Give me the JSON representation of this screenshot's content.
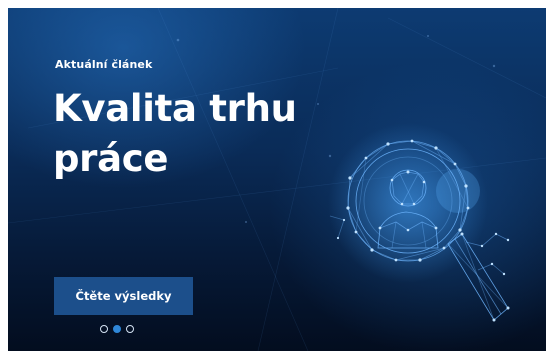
{
  "hero": {
    "eyebrow": "Aktuální článek",
    "headline": "Kvalita trhu práce",
    "cta_label": "Čtěte výsledky",
    "illustration_icon": "magnifier-person-icon",
    "slides": [
      {
        "label": "slide 1",
        "active": false
      },
      {
        "label": "slide 2",
        "active": true
      },
      {
        "label": "slide 3",
        "active": false
      }
    ]
  },
  "colors": {
    "background_top": "#0d3b72",
    "background_bottom": "#030d1f",
    "button": "#1c4f8b",
    "network_lines": "#6fb6ff",
    "dot_active": "#2f87d8",
    "text": "#ffffff"
  }
}
